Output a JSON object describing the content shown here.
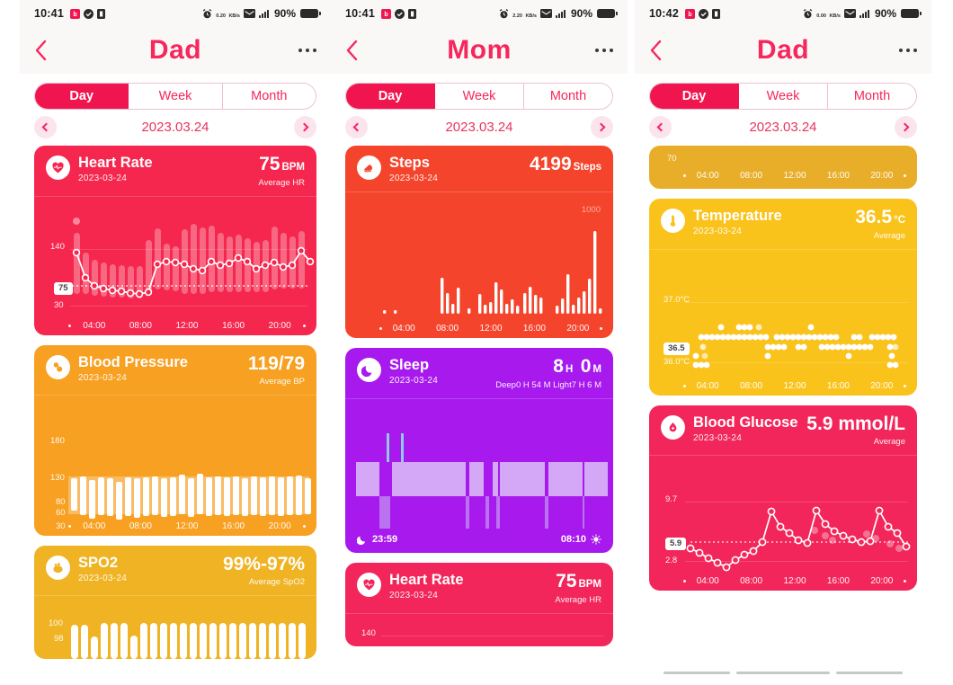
{
  "screens": [
    {
      "statusbar": {
        "time": "10:41",
        "data_rate": "0.20",
        "data_unit": "KB/s",
        "battery_pct": "90%"
      },
      "nav": {
        "title": "Dad",
        "back_icon": "chevron-left-icon",
        "more_icon": "more-options-icon"
      },
      "tabs": [
        {
          "label": "Day",
          "active": true
        },
        {
          "label": "Week",
          "active": false
        },
        {
          "label": "Month",
          "active": false
        }
      ],
      "date": {
        "value": "2023.03.24",
        "prev_icon": "chevron-left-icon",
        "next_icon": "chevron-right-icon"
      },
      "cards": [
        {
          "id": "heart-rate",
          "icon": "heart-rate-icon",
          "title": "Heart Rate",
          "date": "2023-03-24",
          "value": "75",
          "unit": "BPM",
          "subtitle": "Average HR",
          "color": "#F5274E",
          "axis": {
            "top": "140",
            "mid": "75",
            "bottom": "30"
          },
          "xticks": [
            "04:00",
            "08:00",
            "12:00",
            "16:00",
            "20:00"
          ]
        },
        {
          "id": "blood-pressure",
          "icon": "blood-pressure-icon",
          "title": "Blood Pressure",
          "date": "2023-03-24",
          "value": "119/79",
          "unit": "",
          "subtitle": "Average BP",
          "color": "#F7A021",
          "axis": {
            "t180": "180",
            "t130": "130",
            "t80": "80",
            "t60": "60",
            "t30": "30"
          },
          "xticks": [
            "04:00",
            "08:00",
            "12:00",
            "16:00",
            "20:00"
          ]
        },
        {
          "id": "spo2",
          "icon": "spo2-icon",
          "title": "SPO2",
          "date": "2023-03-24",
          "value": "99%-97%",
          "unit": "",
          "subtitle": "Average SpO2",
          "color": "#EFB323",
          "axis": {
            "top": "100",
            "bottom": "98"
          },
          "xticks": []
        }
      ]
    },
    {
      "statusbar": {
        "time": "10:41",
        "data_rate": "2.20",
        "data_unit": "KB/s",
        "battery_pct": "90%"
      },
      "nav": {
        "title": "Mom",
        "back_icon": "chevron-left-icon",
        "more_icon": "more-options-icon"
      },
      "tabs": [
        {
          "label": "Day",
          "active": true
        },
        {
          "label": "Week",
          "active": false
        },
        {
          "label": "Month",
          "active": false
        }
      ],
      "date": {
        "value": "2023.03.24",
        "prev_icon": "chevron-left-icon",
        "next_icon": "chevron-right-icon"
      },
      "cards": [
        {
          "id": "steps",
          "icon": "steps-shoe-icon",
          "title": "Steps",
          "date": "2023-03-24",
          "value": "4199",
          "unit": "Steps",
          "subtitle": "",
          "color": "#F4452C",
          "axis": {
            "top": "1000"
          },
          "xticks": [
            "04:00",
            "08:00",
            "12:00",
            "16:00",
            "20:00"
          ]
        },
        {
          "id": "sleep",
          "icon": "sleep-moon-icon",
          "title": "Sleep",
          "date": "2023-03-24",
          "value_h": "8",
          "unit_h": "H",
          "value_m": "0",
          "unit_m": "M",
          "subtitle": "Deep0 H 54 M  Light7 H 6 M",
          "color": "#A819EE",
          "sleep_start": "23:59",
          "sleep_end": "08:10",
          "start_icon": "moon-icon",
          "end_icon": "sun-icon"
        },
        {
          "id": "heart-rate-2",
          "icon": "heart-rate-icon",
          "title": "Heart Rate",
          "date": "2023-03-24",
          "value": "75",
          "unit": "BPM",
          "subtitle": "Average HR",
          "color": "#F2265A",
          "axis": {
            "top": "140"
          }
        }
      ]
    },
    {
      "statusbar": {
        "time": "10:42",
        "data_rate": "0.00",
        "data_unit": "KB/s",
        "battery_pct": "90%"
      },
      "nav": {
        "title": "Dad",
        "back_icon": "chevron-left-icon",
        "more_icon": "more-options-icon"
      },
      "tabs": [
        {
          "label": "Day",
          "active": true
        },
        {
          "label": "Week",
          "active": false
        },
        {
          "label": "Month",
          "active": false
        }
      ],
      "date": {
        "value": "2023.03.24",
        "prev_icon": "chevron-left-icon",
        "next_icon": "chevron-right-icon"
      },
      "cards": [
        {
          "id": "partial-card",
          "color": "#E8AE2A",
          "axis": {
            "bottom": "70"
          },
          "xticks": [
            "04:00",
            "08:00",
            "12:00",
            "16:00",
            "20:00"
          ]
        },
        {
          "id": "temperature",
          "icon": "thermometer-icon",
          "title": "Temperature",
          "date": "2023-03-24",
          "value": "36.5",
          "unit": "°C",
          "subtitle": "Average",
          "color": "#FAC31C",
          "axis": {
            "top": "37.0°C",
            "mid": "36.5",
            "bottom": "36.0°C"
          },
          "xticks": [
            "04:00",
            "08:00",
            "12:00",
            "16:00",
            "20:00"
          ]
        },
        {
          "id": "blood-glucose",
          "icon": "blood-glucose-icon",
          "title": "Blood Glucose",
          "date": "2023-03-24",
          "value": "5.9 mmol/L",
          "unit": "",
          "subtitle": "Average",
          "color": "#F2265A",
          "axis": {
            "top": "9.7",
            "mid": "5.9",
            "bottom": "2.8"
          },
          "xticks": [
            "04:00",
            "08:00",
            "12:00",
            "16:00",
            "20:00"
          ]
        }
      ]
    }
  ],
  "chart_data": [
    {
      "type": "line",
      "id": "heart-rate-day",
      "title": "Heart Rate",
      "ylabel": "BPM",
      "ylim": [
        30,
        140
      ],
      "average": 75,
      "values": [
        88,
        62,
        58,
        56,
        55,
        54,
        52,
        52,
        56,
        78,
        80,
        80,
        78,
        74,
        73,
        80,
        76,
        77,
        82,
        80,
        74,
        78,
        80,
        76,
        78,
        84,
        92,
        78,
        76,
        82
      ],
      "range_min": [
        55,
        48,
        46,
        45,
        44,
        44,
        43,
        43,
        46,
        58,
        60,
        60,
        58,
        56,
        55,
        60,
        58,
        58,
        62,
        60,
        56,
        58,
        60,
        58,
        59,
        62,
        70,
        58,
        57,
        62
      ],
      "range_max": [
        112,
        82,
        76,
        74,
        72,
        71,
        70,
        70,
        78,
        104,
        100,
        100,
        96,
        92,
        110,
        104,
        112,
        110,
        104,
        100,
        98,
        100,
        104,
        96,
        98,
        112,
        106,
        98,
        92,
        100
      ]
    },
    {
      "type": "bar",
      "id": "blood-pressure-day",
      "title": "Blood Pressure",
      "ylim": [
        30,
        180
      ],
      "systolic_avg": 119,
      "diastolic_avg": 79,
      "systolic": [
        124,
        126,
        122,
        125,
        124,
        120,
        125,
        124,
        125,
        126,
        124,
        125,
        127,
        124,
        128,
        125,
        126,
        125,
        126,
        124,
        126,
        125,
        126,
        125,
        126,
        127,
        124
      ],
      "diastolic": [
        88,
        80,
        78,
        80,
        80,
        84,
        80,
        78,
        79,
        80,
        79,
        80,
        82,
        79,
        80,
        80,
        80,
        79,
        80,
        80,
        80,
        79,
        80,
        80,
        80,
        80,
        84
      ]
    },
    {
      "type": "bar",
      "id": "spo2-day",
      "title": "SPO2",
      "ylim": [
        98,
        100
      ],
      "range": "99%-97%",
      "values": [
        99,
        99,
        98,
        99,
        99,
        99,
        99,
        99,
        99,
        99,
        99,
        99,
        99,
        99,
        99,
        99,
        99,
        99,
        99,
        99,
        99,
        99,
        99,
        99,
        99,
        99,
        99,
        99
      ]
    },
    {
      "type": "bar",
      "id": "steps-day",
      "title": "Steps",
      "total": 4199,
      "ylim": [
        0,
        1000
      ],
      "values": [
        0,
        0,
        0,
        0,
        0,
        15,
        0,
        20,
        0,
        0,
        0,
        0,
        0,
        0,
        0,
        0,
        210,
        120,
        60,
        140,
        0,
        0,
        30,
        0,
        150,
        60,
        50,
        40,
        250,
        180,
        60,
        120,
        40,
        70,
        30,
        160,
        200,
        130,
        110,
        0,
        40,
        130,
        60,
        30,
        110,
        330,
        50,
        160,
        230,
        620,
        20
      ]
    },
    {
      "type": "bar",
      "id": "sleep-day",
      "title": "Sleep",
      "total": "8 H 0 M",
      "deep": "0 H 54 M",
      "light": "7 H 6 M",
      "start": "23:59",
      "end": "08:10",
      "stages": [
        "light",
        "deep",
        "light",
        "awake",
        "light",
        "awake",
        "light",
        "light",
        "light",
        "light",
        "light"
      ]
    },
    {
      "type": "scatter",
      "id": "temperature-day",
      "title": "Temperature",
      "ylabel": "°C",
      "ylim": [
        36.0,
        37.0
      ],
      "average": 36.5,
      "values": [
        36.4,
        36.4,
        36.45,
        36.38,
        36.38,
        36.38,
        36.55,
        36.55,
        36.55,
        36.62,
        36.6,
        36.6,
        36.55,
        36.6,
        36.55,
        36.48,
        36.45,
        36.44,
        36.6,
        36.6,
        36.6,
        36.62,
        36.5,
        36.5,
        36.5,
        36.48,
        36.45,
        36.6,
        36.6,
        36.58,
        36.42
      ]
    },
    {
      "type": "line",
      "id": "blood-glucose-day",
      "title": "Blood Glucose",
      "ylabel": "mmol/L",
      "ylim": [
        2.8,
        9.7
      ],
      "average": 5.9,
      "values": [
        5.0,
        4.8,
        4.4,
        4.2,
        3.9,
        4.5,
        4.8,
        5.0,
        5.8,
        8.9,
        7.5,
        7.0,
        6.4,
        5.6,
        9.0,
        7.6,
        7.0,
        6.7,
        6.4,
        6.0,
        5.7,
        5.8,
        9.0,
        7.5,
        7.0,
        6.6,
        6.2,
        5.9,
        5.5
      ]
    }
  ]
}
